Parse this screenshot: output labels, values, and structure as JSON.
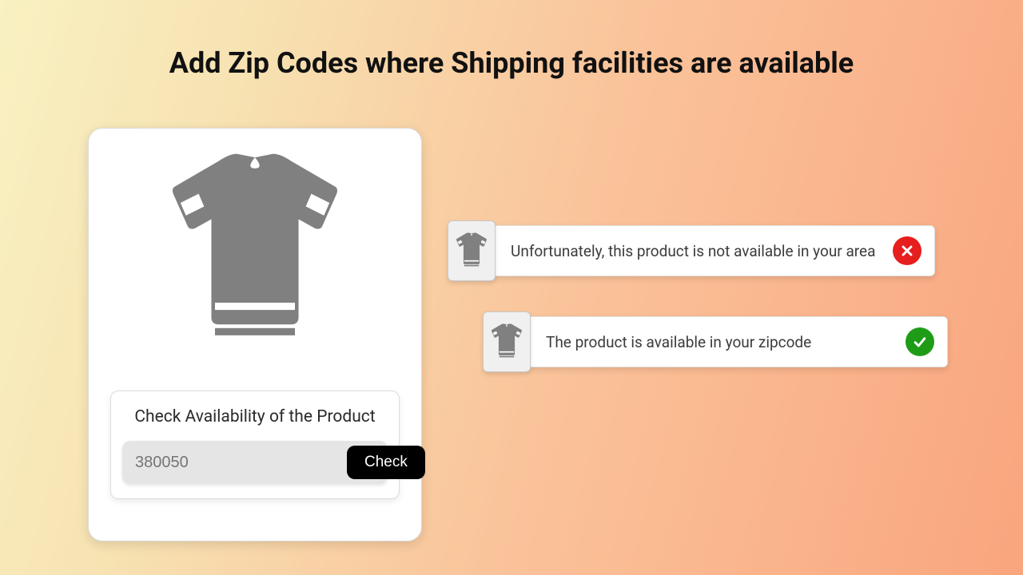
{
  "header": {
    "title": "Add Zip Codes where Shipping facilities are available"
  },
  "product": {
    "availability_heading": "Check Availability of the Product",
    "zip_placeholder": "380050",
    "check_label": "Check"
  },
  "statuses": {
    "error": {
      "message": "Unfortunately, this product is not available in your area"
    },
    "ok": {
      "message": "The product is available in your zipcode"
    }
  },
  "icons": {
    "tshirt": "tshirt-icon",
    "error": "close-circle-icon",
    "ok": "check-circle-icon"
  },
  "colors": {
    "error": "#e61e1e",
    "ok": "#1f9c17",
    "button_bg": "#000000"
  }
}
